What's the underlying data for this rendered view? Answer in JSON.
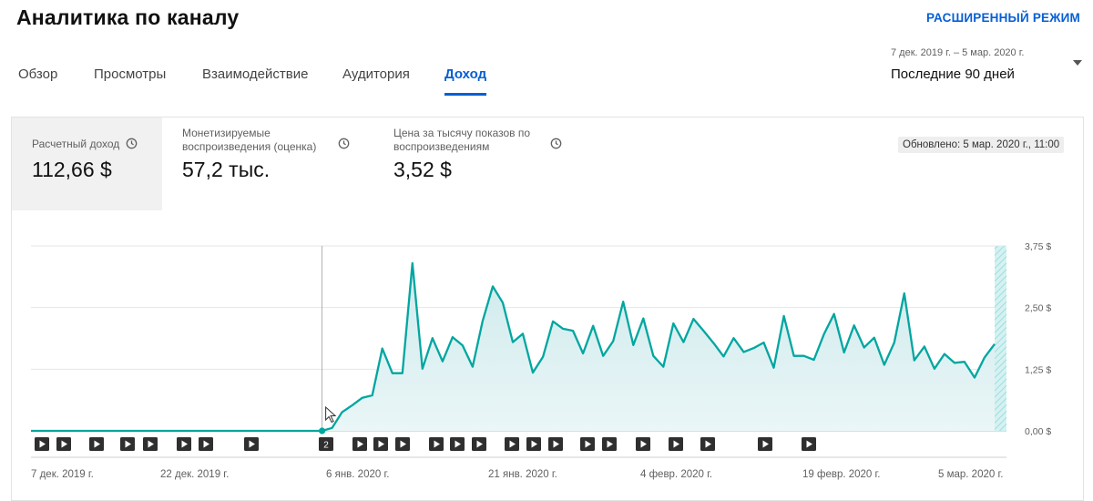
{
  "header": {
    "title": "Аналитика по каналу",
    "advanced_mode": "РАСШИРЕННЫЙ РЕЖИМ"
  },
  "tabs": [
    {
      "label": "Обзор",
      "active": false
    },
    {
      "label": "Просмотры",
      "active": false
    },
    {
      "label": "Взаимодействие",
      "active": false
    },
    {
      "label": "Аудитория",
      "active": false
    },
    {
      "label": "Доход",
      "active": true
    }
  ],
  "period": {
    "range": "7 дек. 2019 г. – 5 мар. 2020 г.",
    "selected": "Последние 90 дней"
  },
  "metrics": [
    {
      "label": "Расчетный доход",
      "value": "112,66 $"
    },
    {
      "label": "Монетизируемые воспроизведения (оценка)",
      "value": "57,2 тыс."
    },
    {
      "label": "Цена за тысячу показов по воспроизведениям",
      "value": "3,52 $"
    }
  ],
  "updated": "Обновлено: 5 мар. 2020 г., 11:00",
  "colors": {
    "accent": "#065fd4",
    "line": "#00a6a0",
    "area": "#d9eef0"
  },
  "chart_data": {
    "type": "area",
    "yticks": [
      "3,75 $",
      "2,50 $",
      "1,25 $",
      "0,00 $"
    ],
    "ylim": [
      0,
      3.75
    ],
    "xtick_labels": [
      "7 дек. 2019 г.",
      "22 дек. 2019 г.",
      "6 янв. 2020 г.",
      "21 янв. 2020 г.",
      "4 февр. 2020 г.",
      "19 февр. 2020 г.",
      "5 мар. 2020 г."
    ],
    "x_start": "2019-12-07",
    "x_end": "2020-03-05",
    "series": [
      {
        "values": [
          0,
          0,
          0,
          0,
          0,
          0,
          0,
          0,
          0,
          0,
          0,
          0,
          0,
          0,
          0,
          0,
          0,
          0,
          0,
          0,
          0,
          0,
          0,
          0,
          0,
          0,
          0,
          0,
          0,
          0,
          0.06,
          0.38,
          0.52,
          0.67,
          0.72,
          1.67,
          1.17,
          1.17,
          3.4,
          1.26,
          1.88,
          1.41,
          1.9,
          1.73,
          1.3,
          2.23,
          2.93,
          2.6,
          1.8,
          1.97,
          1.18,
          1.5,
          2.22,
          2.07,
          2.03,
          1.57,
          2.13,
          1.52,
          1.82,
          2.62,
          1.74,
          2.28,
          1.52,
          1.3,
          2.18,
          1.8,
          2.27,
          2.03,
          1.78,
          1.51,
          1.88,
          1.6,
          1.68,
          1.79,
          1.28,
          2.33,
          1.52,
          1.52,
          1.44,
          1.96,
          2.37,
          1.59,
          2.14,
          1.69,
          1.89,
          1.34,
          1.79,
          2.79,
          1.43,
          1.71,
          1.26,
          1.56,
          1.38,
          1.4,
          1.08,
          1.49,
          1.76
        ]
      }
    ],
    "video_markers": [
      "",
      "",
      "",
      "",
      "",
      "",
      "",
      "",
      "2",
      "",
      "",
      "",
      "",
      "",
      "",
      "",
      "",
      "",
      "",
      "",
      "",
      "",
      "",
      "",
      "",
      "",
      "",
      "",
      "",
      "",
      ""
    ],
    "grid": true
  }
}
